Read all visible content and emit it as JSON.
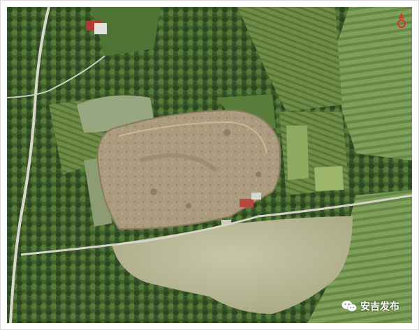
{
  "watermark": {
    "text": "安吉发布",
    "icon": "wechat-icon"
  },
  "compass": {
    "icon": "north-compass-icon",
    "color": "#d7322b"
  },
  "colors": {
    "forest_dark": "#2f4d23",
    "forest": "#4e6e35",
    "pit": "#a89a7e",
    "pond": "#b9bc9a",
    "road": "#d9d6cc",
    "field": "#6d8a47"
  }
}
